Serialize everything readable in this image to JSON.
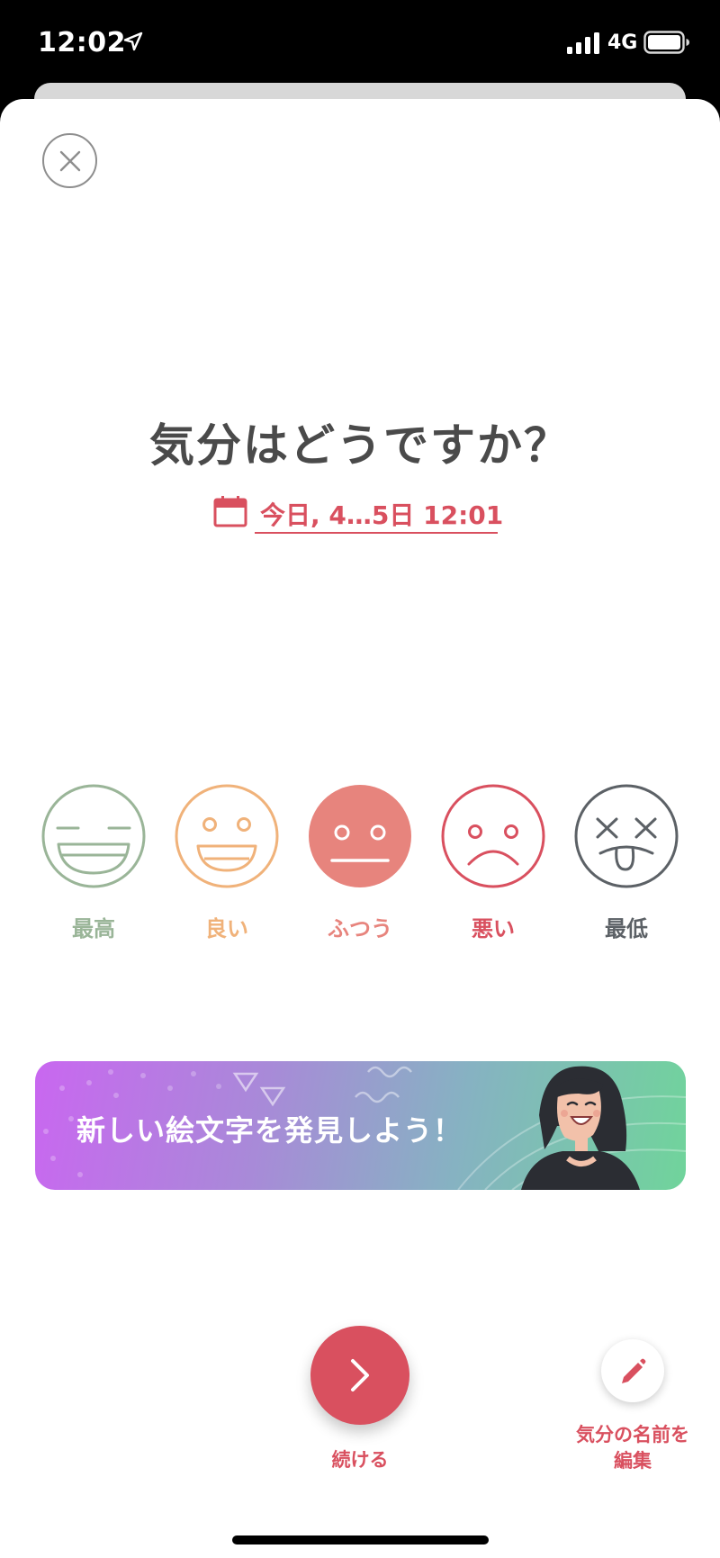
{
  "status_bar": {
    "time": "12:02",
    "network": "4G",
    "icons": [
      "location-arrow-icon",
      "signal-bars-icon",
      "battery-icon"
    ]
  },
  "header": {
    "close_icon": "close-icon"
  },
  "main": {
    "title": "気分はどうですか？",
    "date_label": "今日, 4…5日 12:01",
    "date_icon": "calendar-icon"
  },
  "moods": [
    {
      "label": "最高",
      "icon": "laughing-face-icon",
      "color": "#9ab598",
      "selected": false
    },
    {
      "label": "良い",
      "icon": "smiling-face-icon",
      "color": "#f0b27a",
      "selected": false
    },
    {
      "label": "ふつう",
      "icon": "neutral-face-icon",
      "color": "#e7847d",
      "selected": true
    },
    {
      "label": "悪い",
      "icon": "sad-face-icon",
      "color": "#d9505f",
      "selected": false
    },
    {
      "label": "最低",
      "icon": "dizzy-face-icon",
      "color": "#5c6166",
      "selected": false
    }
  ],
  "banner": {
    "text": "新しい絵文字を発見しよう！",
    "illustration": "laughing-woman-illustration"
  },
  "footer": {
    "continue_label": "続ける",
    "continue_icon": "chevron-right-icon",
    "edit_label_line1": "気分の名前を",
    "edit_label_line2": "編集",
    "edit_icon": "pencil-icon"
  },
  "colors": {
    "accent": "#d9505f",
    "title": "#4a4a4a"
  }
}
